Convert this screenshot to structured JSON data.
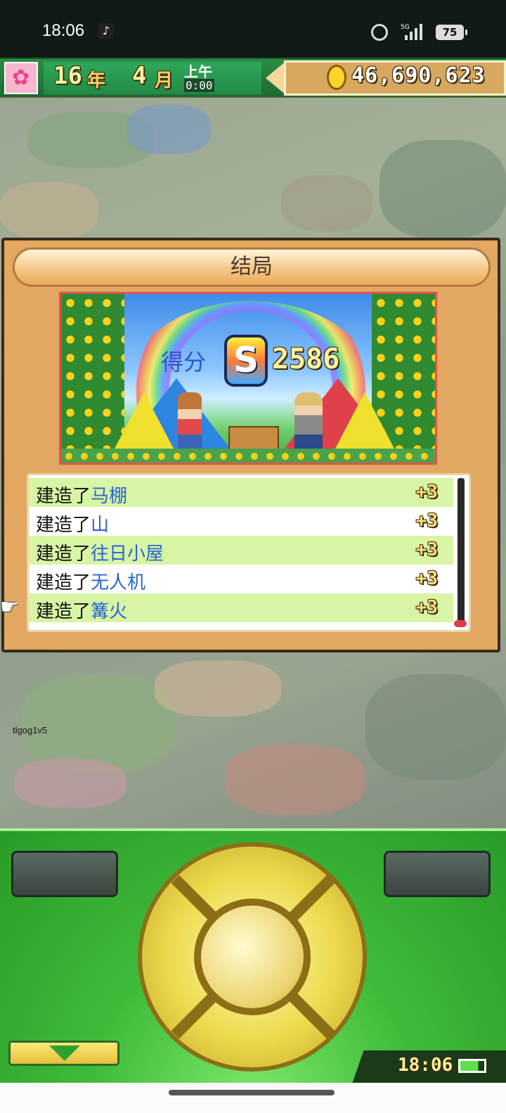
{
  "status_bar": {
    "time": "18:06",
    "network": "5G",
    "battery": "75"
  },
  "top_bar": {
    "year": "16",
    "year_unit": "年",
    "month": "4",
    "month_unit": "月",
    "period": "上午",
    "clock": "0:00",
    "money": "46,690,623"
  },
  "result": {
    "title": "结局",
    "score_label": "得分",
    "rank": "S",
    "score": "2586",
    "items": [
      {
        "prefix": "建造了",
        "object": "马棚",
        "points": "+3"
      },
      {
        "prefix": "建造了",
        "object": "山",
        "points": "+3"
      },
      {
        "prefix": "建造了",
        "object": "往日小屋",
        "points": "+3"
      },
      {
        "prefix": "建造了",
        "object": "无人机",
        "points": "+3"
      },
      {
        "prefix": "建造了",
        "object": "篝火",
        "points": "+3"
      }
    ]
  },
  "watermark": "tlgog1v5",
  "controller": {
    "clock": "18:06"
  },
  "colors": {
    "panel": "#e2a760",
    "row_highlight": "#d7f5a4",
    "object_text": "#2b64d2",
    "controller_green": "#3fbb3a"
  }
}
